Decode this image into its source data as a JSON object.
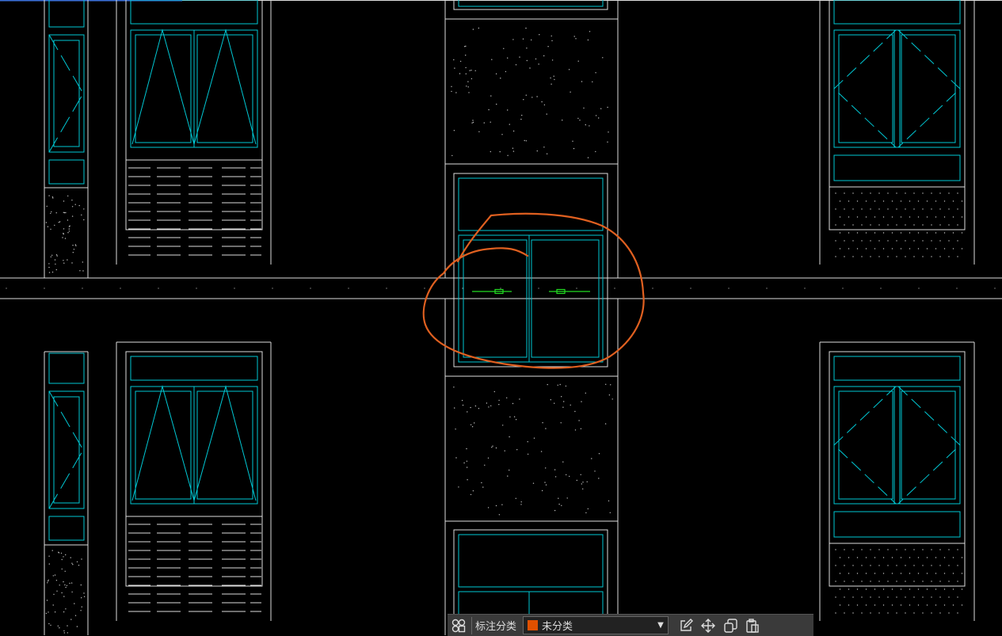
{
  "colors": {
    "background": "#000000",
    "wall_lines": "#dddddd",
    "window_frames": "#00c8d4",
    "annotation_circle": "#e06020",
    "dimension_marks": "#22dd22",
    "toolbar_bg": "#3a3a3a",
    "category_swatch": "#e05000"
  },
  "toolbar": {
    "category_label": "标注分类",
    "category_value": "未分类",
    "icons": [
      "group-icon",
      "edit-icon",
      "move-icon",
      "copy-icon",
      "paste-icon"
    ]
  }
}
